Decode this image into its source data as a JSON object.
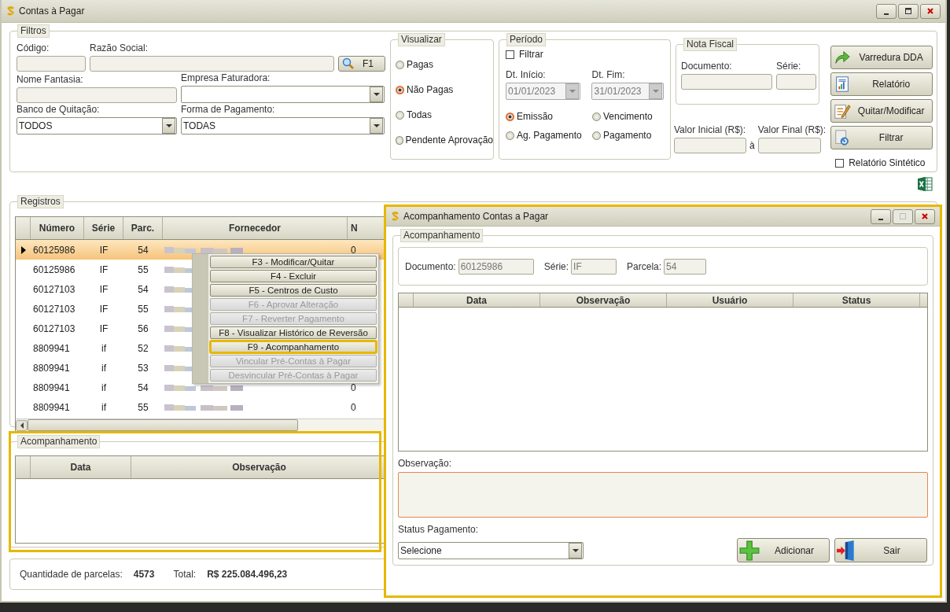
{
  "window": {
    "title": "Contas à Pagar"
  },
  "filters": {
    "title": "Filtros",
    "codigo": {
      "label": "Código:"
    },
    "razao_social": {
      "label": "Razão Social:"
    },
    "search_button": "F1",
    "nome_fantasia": {
      "label": "Nome Fantasia:"
    },
    "empresa_faturadora": {
      "label": "Empresa Faturadora:"
    },
    "banco": {
      "label": "Banco de Quitação:",
      "value": "TODOS"
    },
    "forma": {
      "label": "Forma de Pagamento:",
      "value": "TODAS"
    }
  },
  "visualizar": {
    "title": "Visualizar",
    "options": [
      {
        "label": "Pagas",
        "selected": false
      },
      {
        "label": "Não Pagas",
        "selected": true
      },
      {
        "label": "Todas",
        "selected": false
      },
      {
        "label": "Pendente Aprovação",
        "selected": false
      }
    ]
  },
  "periodo": {
    "title": "Período",
    "filtrar": {
      "label": "Filtrar",
      "checked": false
    },
    "inicio": {
      "label": "Dt. Início:",
      "value": "01/01/2023",
      "disabled": true
    },
    "fim": {
      "label": "Dt. Fim:",
      "value": "31/01/2023",
      "disabled": true
    },
    "options": [
      {
        "label": "Emissão",
        "selected": true
      },
      {
        "label": "Vencimento",
        "selected": false
      },
      {
        "label": "Ag. Pagamento",
        "selected": false
      },
      {
        "label": "Pagamento",
        "selected": false
      }
    ]
  },
  "nota_fiscal": {
    "title": "Nota Fiscal",
    "documento": {
      "label": "Documento:"
    },
    "serie": {
      "label": "Série:"
    }
  },
  "valor": {
    "inicial": {
      "label": "Valor Inicial (R$):"
    },
    "separator": "à",
    "final": {
      "label": "Valor Final (R$):"
    }
  },
  "actions": [
    {
      "label": "Varredura DDA",
      "kind": "arrow"
    },
    {
      "label": "Relatório",
      "kind": "report"
    },
    {
      "label": "Quitar/Modificar",
      "kind": "edit"
    },
    {
      "label": "Filtrar",
      "kind": "filter"
    }
  ],
  "relatorio_sintetico": {
    "label": "Relatório Sintético",
    "checked": false
  },
  "registros": {
    "title": "Registros",
    "columns": [
      "Número",
      "Série",
      "Parc.",
      "Fornecedor",
      "N"
    ],
    "rows": [
      {
        "numero": "60125986",
        "serie": "IF",
        "parc": "54",
        "column_5": "0",
        "selected": true
      },
      {
        "numero": "60125986",
        "serie": "IF",
        "parc": "55",
        "selected": false
      },
      {
        "numero": "60127103",
        "serie": "IF",
        "parc": "54",
        "selected": false
      },
      {
        "numero": "60127103",
        "serie": "IF",
        "parc": "55",
        "selected": false
      },
      {
        "numero": "60127103",
        "serie": "IF",
        "parc": "56",
        "selected": false
      },
      {
        "numero": "8809941",
        "serie": "if",
        "parc": "52",
        "selected": false
      },
      {
        "numero": "8809941",
        "serie": "if",
        "parc": "53",
        "selected": false
      },
      {
        "numero": "8809941",
        "serie": "if",
        "parc": "54",
        "column_5": "0",
        "selected": false
      },
      {
        "numero": "8809941",
        "serie": "if",
        "parc": "55",
        "column_5": "0",
        "selected": false
      }
    ]
  },
  "context_menu": [
    {
      "label": "F3 - Modificar/Quitar",
      "disabled": false,
      "highlighted": false
    },
    {
      "label": "F4 - Excluir",
      "disabled": false,
      "highlighted": false
    },
    {
      "label": "F5 - Centros de Custo",
      "disabled": false,
      "highlighted": false
    },
    {
      "label": "F6 - Aprovar Alteração",
      "disabled": true,
      "highlighted": false
    },
    {
      "label": "F7 - Reverter Pagamento",
      "disabled": true,
      "highlighted": false
    },
    {
      "label": "F8 - Visualizar Histórico de Reversão",
      "disabled": false,
      "highlighted": false
    },
    {
      "label": "F9 - Acompanhamento",
      "disabled": false,
      "highlighted": true
    },
    {
      "label": "Vincular Pré-Contas à Pagar",
      "disabled": true,
      "highlighted": false
    },
    {
      "label": "Desvincular Pré-Contas à Pagar",
      "disabled": true,
      "highlighted": false
    }
  ],
  "acompanhamento": {
    "title": "Acompanhamento",
    "columns": [
      "Data",
      "Observação"
    ]
  },
  "summary": {
    "quantidade_label": "Quantidade de parcelas:",
    "quantidade": "4573",
    "total_label": "Total:",
    "total": "R$ 225.084.496,23"
  },
  "dialog": {
    "title": "Acompanhamento Contas a Pagar",
    "group_title": "Acompanhamento",
    "documento": {
      "label": "Documento:",
      "value": "60125986"
    },
    "serie": {
      "label": "Série:",
      "value": "IF"
    },
    "parcela": {
      "label": "Parcela:",
      "value": "54"
    },
    "columns": [
      "Data",
      "Observação",
      "Usuário",
      "Status"
    ],
    "observacao_label": "Observação:",
    "status": {
      "label": "Status Pagamento:",
      "value": "Selecione"
    },
    "buttons": [
      {
        "label": "Adicionar",
        "kind": "add"
      },
      {
        "label": "Sair",
        "kind": "exit"
      }
    ]
  }
}
